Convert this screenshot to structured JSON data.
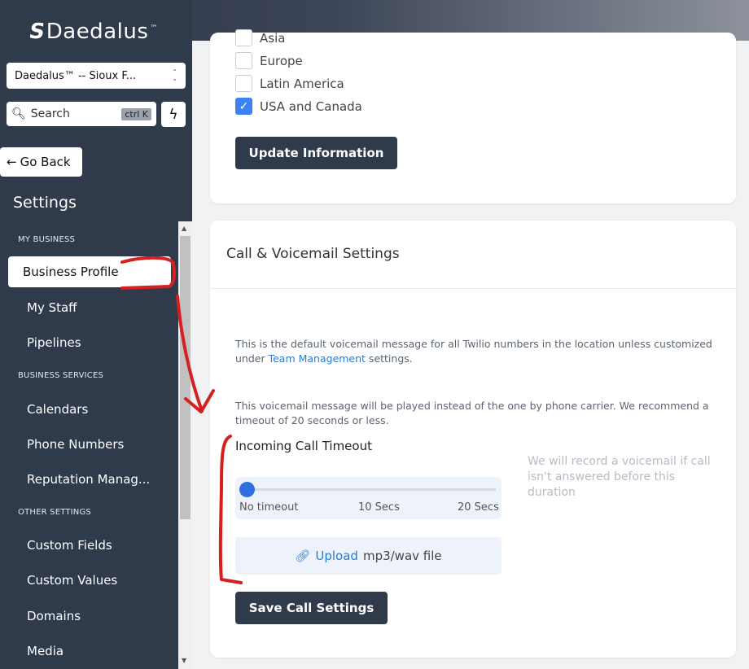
{
  "brand": {
    "name": "Daedalus",
    "tm": "™"
  },
  "location": {
    "value": "Daedalus™ -- Sioux F..."
  },
  "search": {
    "label": "Search",
    "shortcut": "ctrl K"
  },
  "nav": {
    "go_back": "Go Back",
    "title": "Settings",
    "sections": [
      {
        "label": "MY BUSINESS",
        "items": [
          "Business Profile",
          "My Staff",
          "Pipelines"
        ]
      },
      {
        "label": "BUSINESS SERVICES",
        "items": [
          "Calendars",
          "Phone Numbers",
          "Reputation Manag..."
        ]
      },
      {
        "label": "OTHER SETTINGS",
        "items": [
          "Custom Fields",
          "Custom Values",
          "Domains",
          "Media"
        ]
      }
    ],
    "active": "Business Profile"
  },
  "regions": {
    "items": [
      {
        "label": "Asia",
        "checked": false
      },
      {
        "label": "Europe",
        "checked": false
      },
      {
        "label": "Latin America",
        "checked": false
      },
      {
        "label": "USA and Canada",
        "checked": true
      }
    ],
    "update_button": "Update Information"
  },
  "call_settings": {
    "title": "Call & Voicemail Settings",
    "para1_a": "This is the default voicemail message for all Twilio numbers in the location unless customized under ",
    "para1_link": "Team Management",
    "para1_b": " settings.",
    "para2": "This voicemail message will be played instead of the one by phone carrier. We recommend a timeout of 20 seconds or less.",
    "timeout_label": "Incoming Call Timeout",
    "slider": {
      "value": 0,
      "ticks": [
        "No timeout",
        "10 Secs",
        "20 Secs"
      ]
    },
    "hint": "We will record a voicemail if call isn't answered before this duration",
    "upload_link": "Upload",
    "upload_text": "mp3/wav file",
    "save_button": "Save Call Settings"
  },
  "colors": {
    "sidebar": "#2f3a4b",
    "accent": "#2b7cd3",
    "annotation": "#d61f1f"
  }
}
